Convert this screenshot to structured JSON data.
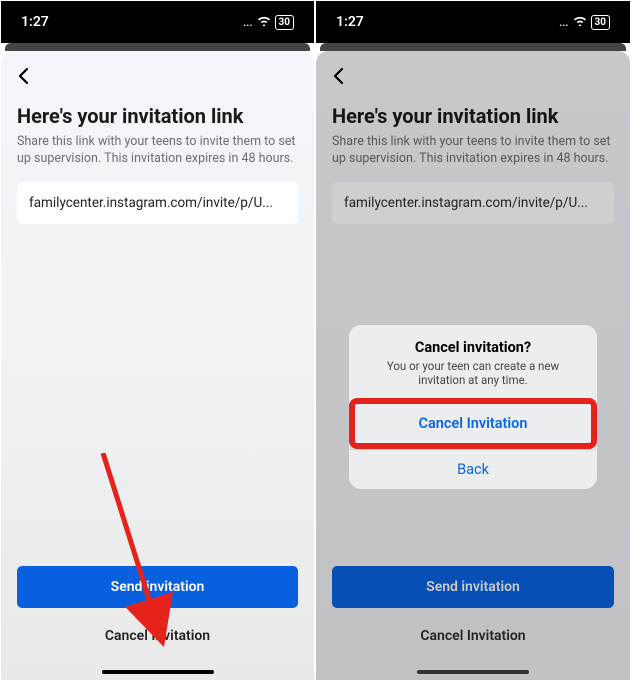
{
  "status": {
    "time": "1:27",
    "dots": "...",
    "battery": "30"
  },
  "page": {
    "title": "Here's your invitation link",
    "subtitle": "Share this link with your teens to invite them to set up supervision. This invitation expires in 48 hours.",
    "link": "familycenter.instagram.com/invite/p/U...",
    "send": "Send invitation",
    "cancel": "Cancel Invitation"
  },
  "popup": {
    "title": "Cancel invitation?",
    "subtitle": "You or your teen can create a new invitation at any time.",
    "confirm": "Cancel Invitation",
    "back": "Back"
  }
}
